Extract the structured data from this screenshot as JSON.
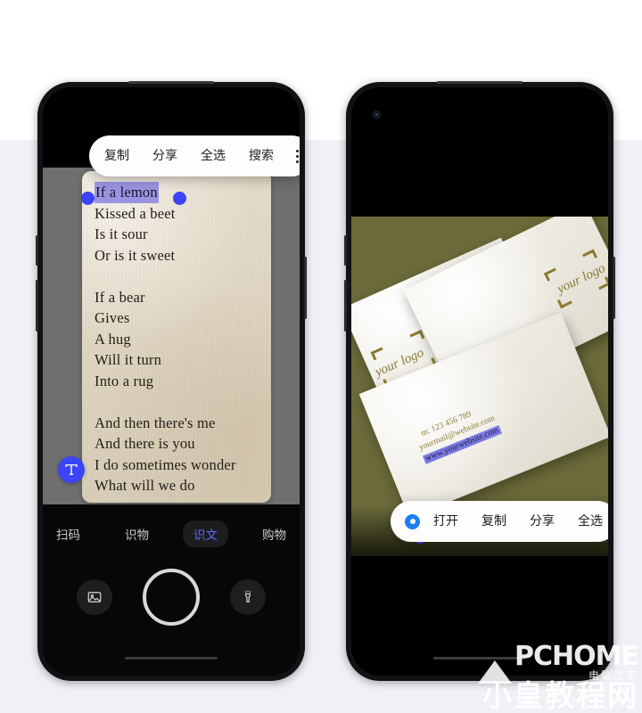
{
  "page": {
    "background_top": "#ffffff",
    "background_main": "#eff1f6"
  },
  "left_phone": {
    "app_mode": "text-scan-camera",
    "context_menu": {
      "items": [
        {
          "label": "复制",
          "name": "copy"
        },
        {
          "label": "分享",
          "name": "share"
        },
        {
          "label": "全选",
          "name": "select-all"
        },
        {
          "label": "搜索",
          "name": "search"
        }
      ],
      "overflow_icon": "more-vertical-icon"
    },
    "scanned_text": {
      "selected_line": "If a lemon",
      "lines": [
        "Kissed a beet",
        "Is it sour",
        "Or is it sweet",
        "",
        "If a bear",
        "Gives",
        "A hug",
        "Will it turn",
        "Into a rug",
        "",
        "And then there's me",
        "And there is you",
        "I do sometimes wonder",
        "What will we do"
      ]
    },
    "ocr_badge_icon": "text-recognition-icon",
    "selection_handle_color": "#3b44f6",
    "selection_highlight_color": "#9b93e0",
    "mode_tabs": [
      {
        "label": "扫码",
        "active": false
      },
      {
        "label": "识物",
        "active": false
      },
      {
        "label": "识文",
        "active": true
      },
      {
        "label": "购物",
        "active": false
      }
    ],
    "active_tab_color": "#5a68ff",
    "controls": {
      "gallery_icon": "image-gallery-icon",
      "shutter": "shutter-button",
      "torch_icon": "flashlight-icon"
    }
  },
  "right_phone": {
    "app_mode": "photo-text-selection",
    "context_menu": {
      "radio_icon": "open-link-radio-icon",
      "items": [
        {
          "label": "打开",
          "name": "open"
        },
        {
          "label": "复制",
          "name": "copy"
        },
        {
          "label": "分享",
          "name": "share"
        },
        {
          "label": "全选",
          "name": "select-all"
        }
      ]
    },
    "photo": {
      "background_color": "#6a6b39",
      "logo_text": "your logo",
      "contact_lines": [
        "m: 123 456 789",
        "w: www.yourwebsite.com"
      ],
      "email_line": "yourmail@website.com",
      "selected_text": "www.yourwebsite.com"
    },
    "selection_handle_color": "#3b44f6",
    "radio_color": "#1b7ef5"
  },
  "watermark": {
    "brand": "PCHOME",
    "brand_sub": "电脑之家",
    "site": "小皇教程网"
  }
}
